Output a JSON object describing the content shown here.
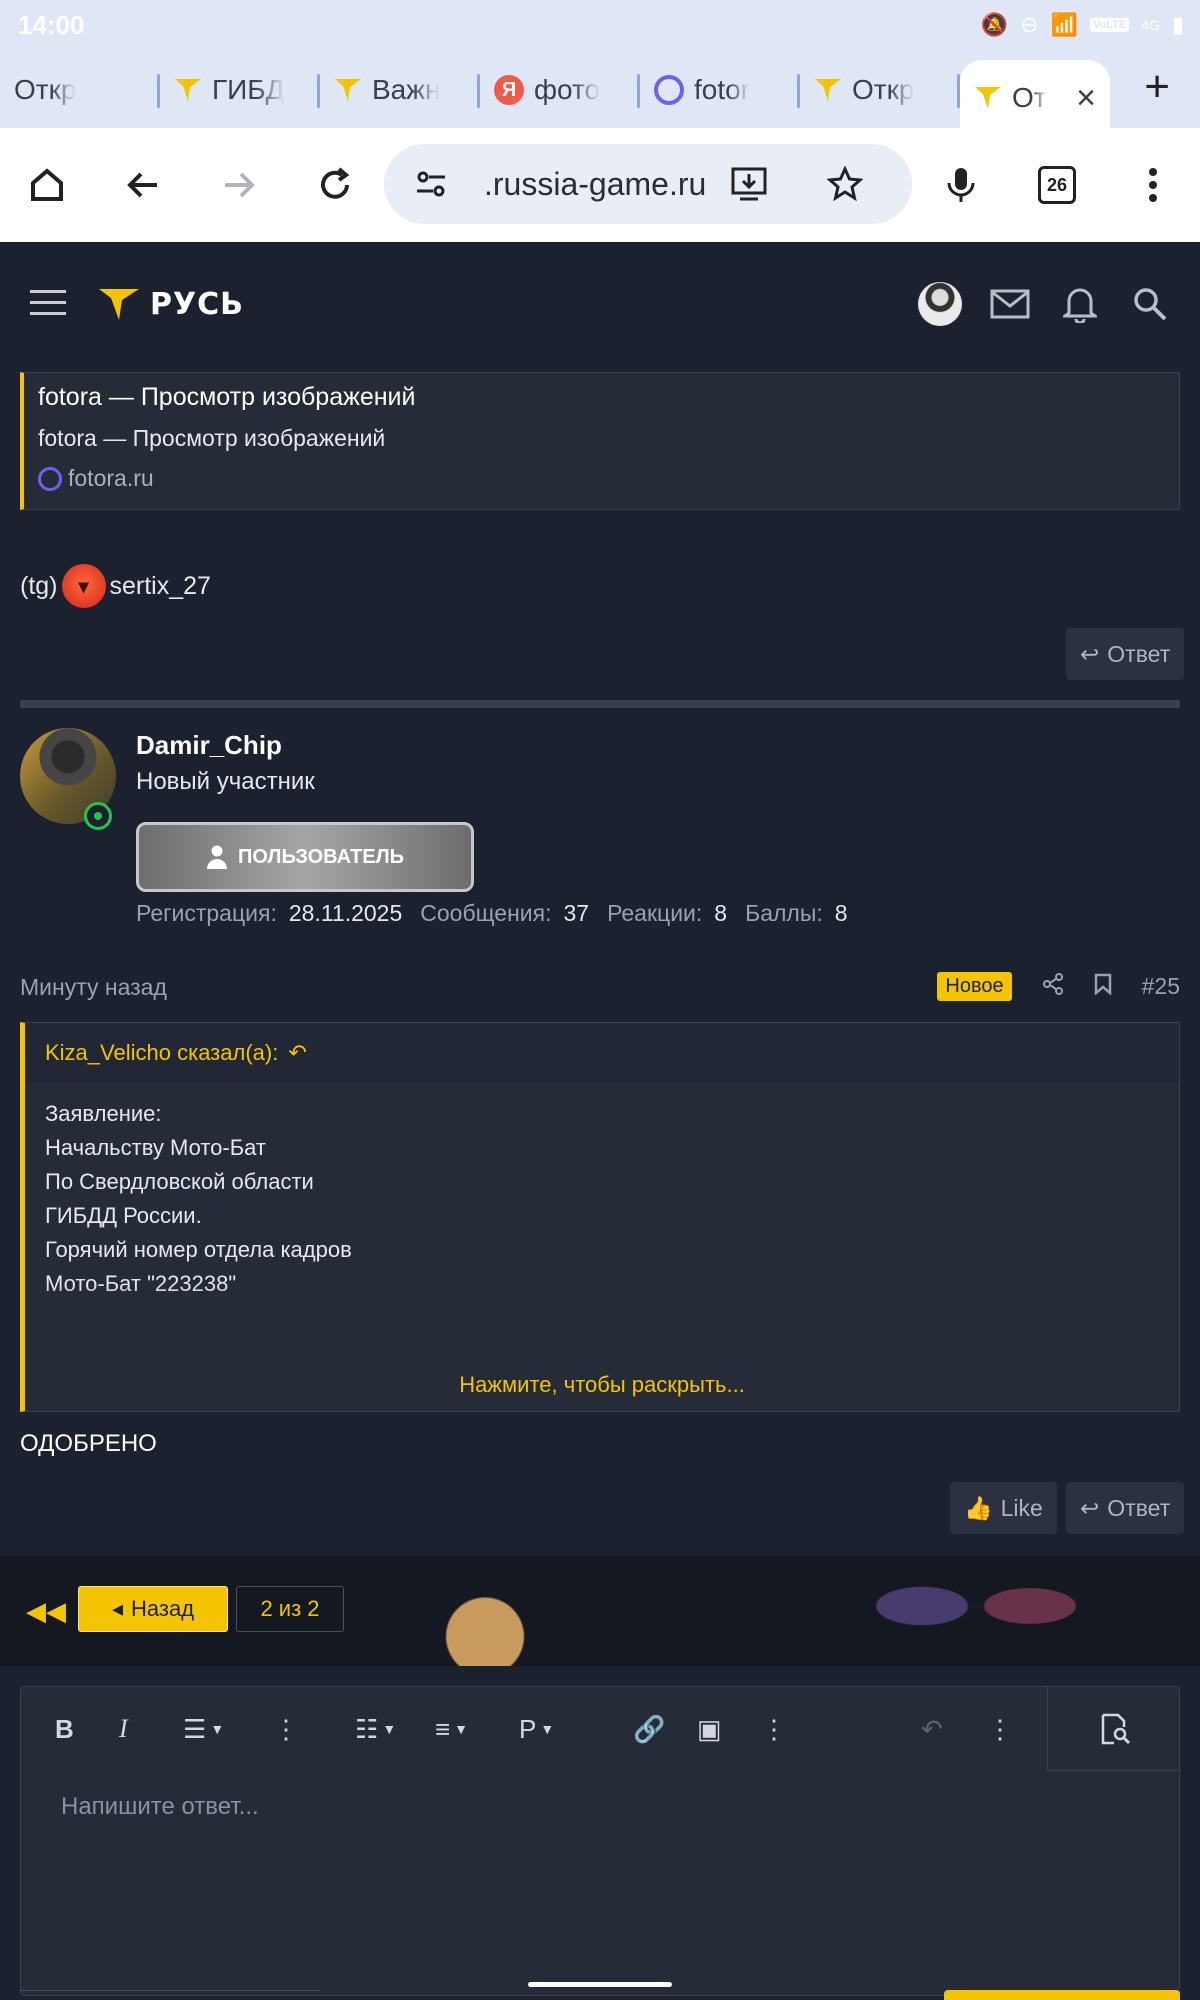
{
  "status_bar": {
    "time": "14:00",
    "net_badge": "VoLTE",
    "net_type": "4G"
  },
  "tabs": [
    {
      "label": "Откр",
      "icon": "none"
    },
    {
      "label": "ГИБД",
      "icon": "rus-logo-icon"
    },
    {
      "label": "Важн",
      "icon": "rus-logo-icon"
    },
    {
      "label": "фото",
      "icon": "yandex-icon"
    },
    {
      "label": "fotor",
      "icon": "ring-icon"
    },
    {
      "label": "Откр",
      "icon": "rus-logo-icon"
    },
    {
      "label": "От",
      "icon": "rus-logo-icon",
      "active": true
    }
  ],
  "toolbar": {
    "url": ".russia-game.ru",
    "tab_count": "26"
  },
  "site": {
    "brand": "РУСЬ",
    "accent": "#f5c400"
  },
  "link_card": {
    "title": "fotora — Просмотр изображений",
    "description": "fotora — Просмотр изображений",
    "domain": "fotora.ru"
  },
  "signature": {
    "prefix": "(tg)",
    "handle": "sertix_27"
  },
  "reply_label": "Ответ",
  "like_label": "Like",
  "post": {
    "username": "Damir_Chip",
    "user_title": "Новый участник",
    "role": "ПОЛЬЗОВАТЕЛЬ",
    "stats": {
      "reg_label": "Регистрация:",
      "reg_value": "28.11.2025",
      "msg_label": "Сообщения:",
      "msg_value": "37",
      "react_label": "Реакции:",
      "react_value": "8",
      "points_label": "Баллы:",
      "points_value": "8"
    },
    "time": "Минуту назад",
    "new_badge": "Новое",
    "number": "#25",
    "quote": {
      "author": "Kiza_Velicho сказал(а):",
      "lines": [
        "Заявление:",
        "Начальству Мото-Бат",
        "По Свердловской области",
        "ГИБДД России.",
        "Горячий номер отдела кадров",
        "Мото-Бат \"223238\""
      ],
      "expand": "Нажмите, чтобы раскрыть..."
    },
    "body": "ОДОБРЕНО"
  },
  "pagination": {
    "prev": "Назад",
    "indicator": "2 из 2"
  },
  "editor": {
    "placeholder": "Напишите ответ..."
  }
}
